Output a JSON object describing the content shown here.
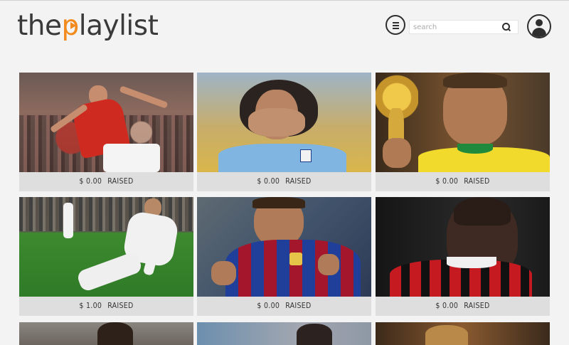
{
  "header": {
    "logo_pre": "the",
    "logo_accent": "p",
    "logo_post": "laylist",
    "search_placeholder": "search",
    "colors": {
      "accent": "#f28a1e",
      "ink": "#2e2e2e"
    }
  },
  "cards": [
    {
      "amount": "$ 0.00",
      "status": "RAISED",
      "subject": "player-red-kit-celebrating"
    },
    {
      "amount": "$ 0.00",
      "status": "RAISED",
      "subject": "player-sky-blue-kit-blowing-kiss"
    },
    {
      "amount": "$ 0.00",
      "status": "RAISED",
      "subject": "player-holding-gold-trophy"
    },
    {
      "amount": "$ 1.00",
      "status": "RAISED",
      "subject": "player-white-kit-knee-slide"
    },
    {
      "amount": "$ 0.00",
      "status": "RAISED",
      "subject": "player-blue-red-stripes-shouting"
    },
    {
      "amount": "$ 0.00",
      "status": "RAISED",
      "subject": "player-red-black-stripes"
    },
    {
      "amount": "",
      "status": "",
      "subject": "player-partial"
    },
    {
      "amount": "",
      "status": "",
      "subject": "player-partial"
    },
    {
      "amount": "",
      "status": "",
      "subject": "player-partial"
    }
  ]
}
